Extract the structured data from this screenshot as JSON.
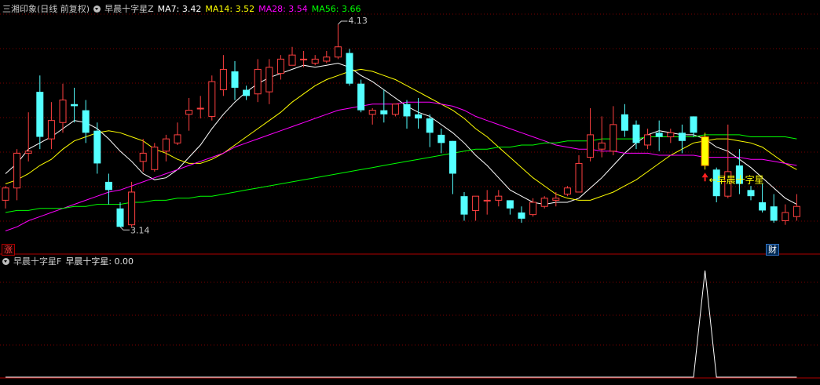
{
  "main_panel": {
    "stock": "三湘印象(日线 前复权)",
    "indicator": "早晨十字星Z",
    "ma": [
      {
        "label": "MA7: 3.42",
        "color": "#ffffff"
      },
      {
        "label": "MA14: 3.52",
        "color": "#ffff00"
      },
      {
        "label": "MA28: 3.54",
        "color": "#ff00ff"
      },
      {
        "label": "MA56: 3.66",
        "color": "#00ff00"
      }
    ],
    "high_label": "4.13",
    "low_label": "3.14",
    "signal_label": "←早晨十字星",
    "badge_up": "涨",
    "badge_cai": "财"
  },
  "sub_panel": {
    "indicator": "早晨十字星F",
    "value_label": "早晨十字星: 0.00"
  },
  "colors": {
    "up": "#ff4040",
    "down": "#54ffff",
    "signal": "#ffff00",
    "grid": "#7a0000"
  },
  "candles": [
    [
      3.27,
      3.33,
      3.34,
      3.23
    ],
    [
      3.33,
      3.5,
      3.52,
      3.27
    ],
    [
      3.5,
      3.51,
      3.7,
      3.46
    ],
    [
      3.8,
      3.58,
      3.88,
      3.52
    ],
    [
      3.57,
      3.66,
      3.75,
      3.52
    ],
    [
      3.65,
      3.76,
      3.84,
      3.6
    ],
    [
      3.74,
      3.73,
      3.82,
      3.65
    ],
    [
      3.71,
      3.6,
      3.76,
      3.55
    ],
    [
      3.61,
      3.45,
      3.65,
      3.4
    ],
    [
      3.36,
      3.32,
      3.4,
      3.25
    ],
    [
      3.23,
      3.14,
      3.26,
      3.14
    ],
    [
      3.15,
      3.31,
      3.36,
      3.14
    ],
    [
      3.46,
      3.5,
      3.57,
      3.41
    ],
    [
      3.42,
      3.53,
      3.55,
      3.41
    ],
    [
      3.51,
      3.57,
      3.59,
      3.46
    ],
    [
      3.55,
      3.59,
      3.65,
      3.54
    ],
    [
      3.69,
      3.71,
      3.77,
      3.61
    ],
    [
      3.72,
      3.72,
      3.78,
      3.67
    ],
    [
      3.68,
      3.85,
      3.88,
      3.66
    ],
    [
      3.81,
      3.91,
      3.98,
      3.78
    ],
    [
      3.9,
      3.82,
      3.95,
      3.76
    ],
    [
      3.81,
      3.78,
      3.83,
      3.76
    ],
    [
      3.79,
      3.91,
      3.96,
      3.75
    ],
    [
      3.8,
      3.92,
      3.96,
      3.74
    ],
    [
      3.89,
      3.96,
      3.98,
      3.86
    ],
    [
      3.93,
      3.98,
      4.02,
      3.93
    ],
    [
      3.96,
      3.96,
      4.0,
      3.92
    ],
    [
      3.94,
      3.96,
      3.98,
      3.93
    ],
    [
      3.95,
      3.97,
      4.0,
      3.94
    ],
    [
      3.97,
      4.02,
      4.13,
      3.96
    ],
    [
      3.99,
      3.84,
      4.01,
      3.83
    ],
    [
      3.84,
      3.71,
      3.86,
      3.7
    ],
    [
      3.69,
      3.71,
      3.72,
      3.64
    ],
    [
      3.71,
      3.69,
      3.81,
      3.65
    ],
    [
      3.69,
      3.74,
      3.74,
      3.68
    ],
    [
      3.74,
      3.68,
      3.76,
      3.62
    ],
    [
      3.69,
      3.67,
      3.77,
      3.62
    ],
    [
      3.67,
      3.6,
      3.69,
      3.53
    ],
    [
      3.59,
      3.55,
      3.62,
      3.5
    ],
    [
      3.56,
      3.4,
      3.56,
      3.3
    ],
    [
      3.29,
      3.2,
      3.31,
      3.17
    ],
    [
      3.22,
      3.29,
      3.29,
      3.17
    ],
    [
      3.27,
      3.27,
      3.32,
      3.2
    ],
    [
      3.27,
      3.29,
      3.32,
      3.24
    ],
    [
      3.27,
      3.23,
      3.27,
      3.2
    ],
    [
      3.21,
      3.18,
      3.24,
      3.16
    ],
    [
      3.2,
      3.26,
      3.28,
      3.19
    ],
    [
      3.24,
      3.28,
      3.29,
      3.23
    ],
    [
      3.27,
      3.28,
      3.31,
      3.24
    ],
    [
      3.3,
      3.33,
      3.34,
      3.29
    ],
    [
      3.31,
      3.45,
      3.49,
      3.31
    ],
    [
      3.48,
      3.59,
      3.72,
      3.46
    ],
    [
      3.52,
      3.55,
      3.68,
      3.48
    ],
    [
      3.51,
      3.64,
      3.73,
      3.49
    ],
    [
      3.69,
      3.61,
      3.74,
      3.58
    ],
    [
      3.64,
      3.55,
      3.66,
      3.52
    ],
    [
      3.54,
      3.59,
      3.62,
      3.52
    ],
    [
      3.6,
      3.58,
      3.66,
      3.51
    ],
    [
      3.58,
      3.6,
      3.62,
      3.55
    ],
    [
      3.6,
      3.56,
      3.64,
      3.5
    ],
    [
      3.68,
      3.6,
      3.68,
      3.58
    ],
    [
      3.58,
      3.44,
      3.6,
      3.42
    ],
    [
      3.42,
      3.29,
      3.43,
      3.26
    ],
    [
      3.29,
      3.41,
      3.64,
      3.28
    ],
    [
      3.44,
      3.35,
      3.52,
      3.3
    ],
    [
      3.32,
      3.29,
      3.34,
      3.27
    ],
    [
      3.26,
      3.22,
      3.35,
      3.21
    ],
    [
      3.24,
      3.17,
      3.3,
      3.16
    ],
    [
      3.17,
      3.21,
      3.25,
      3.15
    ],
    [
      3.19,
      3.24,
      3.3,
      3.17
    ]
  ],
  "ma_series": {
    "ma7": [
      3.4,
      3.45,
      3.52,
      3.55,
      3.58,
      3.62,
      3.66,
      3.65,
      3.62,
      3.57,
      3.51,
      3.46,
      3.4,
      3.37,
      3.38,
      3.42,
      3.48,
      3.54,
      3.62,
      3.69,
      3.75,
      3.8,
      3.84,
      3.87,
      3.89,
      3.91,
      3.93,
      3.92,
      3.93,
      3.94,
      3.92,
      3.88,
      3.85,
      3.81,
      3.77,
      3.73,
      3.7,
      3.68,
      3.64,
      3.6,
      3.55,
      3.49,
      3.44,
      3.38,
      3.32,
      3.29,
      3.26,
      3.25,
      3.26,
      3.26,
      3.28,
      3.33,
      3.38,
      3.44,
      3.5,
      3.55,
      3.59,
      3.61,
      3.6,
      3.59,
      3.59,
      3.57,
      3.53,
      3.51,
      3.47,
      3.43,
      3.38,
      3.33,
      3.28,
      3.25
    ],
    "ma14": [
      3.35,
      3.37,
      3.4,
      3.44,
      3.47,
      3.52,
      3.56,
      3.58,
      3.6,
      3.61,
      3.6,
      3.58,
      3.56,
      3.52,
      3.5,
      3.47,
      3.45,
      3.45,
      3.47,
      3.5,
      3.54,
      3.58,
      3.62,
      3.66,
      3.7,
      3.75,
      3.79,
      3.83,
      3.86,
      3.88,
      3.9,
      3.91,
      3.9,
      3.88,
      3.86,
      3.83,
      3.8,
      3.77,
      3.74,
      3.71,
      3.67,
      3.62,
      3.58,
      3.53,
      3.48,
      3.43,
      3.38,
      3.34,
      3.3,
      3.28,
      3.27,
      3.27,
      3.29,
      3.31,
      3.34,
      3.37,
      3.41,
      3.45,
      3.49,
      3.52,
      3.55,
      3.56,
      3.57,
      3.57,
      3.56,
      3.55,
      3.53,
      3.49,
      3.45,
      3.42
    ],
    "ma28": [
      3.12,
      3.14,
      3.17,
      3.19,
      3.21,
      3.23,
      3.25,
      3.27,
      3.29,
      3.31,
      3.32,
      3.34,
      3.36,
      3.38,
      3.4,
      3.42,
      3.44,
      3.46,
      3.48,
      3.5,
      3.53,
      3.55,
      3.57,
      3.59,
      3.61,
      3.63,
      3.65,
      3.67,
      3.69,
      3.71,
      3.72,
      3.73,
      3.74,
      3.74,
      3.74,
      3.75,
      3.75,
      3.75,
      3.74,
      3.73,
      3.71,
      3.68,
      3.66,
      3.64,
      3.62,
      3.6,
      3.58,
      3.56,
      3.54,
      3.53,
      3.52,
      3.52,
      3.51,
      3.51,
      3.5,
      3.5,
      3.5,
      3.49,
      3.49,
      3.49,
      3.49,
      3.48,
      3.48,
      3.48,
      3.48,
      3.47,
      3.47,
      3.46,
      3.45,
      3.44
    ],
    "ma56": [
      3.21,
      3.22,
      3.22,
      3.23,
      3.23,
      3.23,
      3.24,
      3.24,
      3.25,
      3.25,
      3.25,
      3.26,
      3.26,
      3.27,
      3.27,
      3.28,
      3.28,
      3.29,
      3.29,
      3.3,
      3.31,
      3.32,
      3.33,
      3.34,
      3.35,
      3.36,
      3.37,
      3.38,
      3.39,
      3.4,
      3.41,
      3.42,
      3.43,
      3.44,
      3.45,
      3.46,
      3.47,
      3.48,
      3.49,
      3.5,
      3.51,
      3.52,
      3.52,
      3.53,
      3.53,
      3.54,
      3.54,
      3.55,
      3.55,
      3.56,
      3.56,
      3.56,
      3.57,
      3.57,
      3.57,
      3.57,
      3.58,
      3.58,
      3.58,
      3.58,
      3.58,
      3.59,
      3.59,
      3.59,
      3.59,
      3.58,
      3.58,
      3.58,
      3.58,
      3.57
    ]
  },
  "signal_candle_index": 61,
  "sub_signal_index": 61
}
